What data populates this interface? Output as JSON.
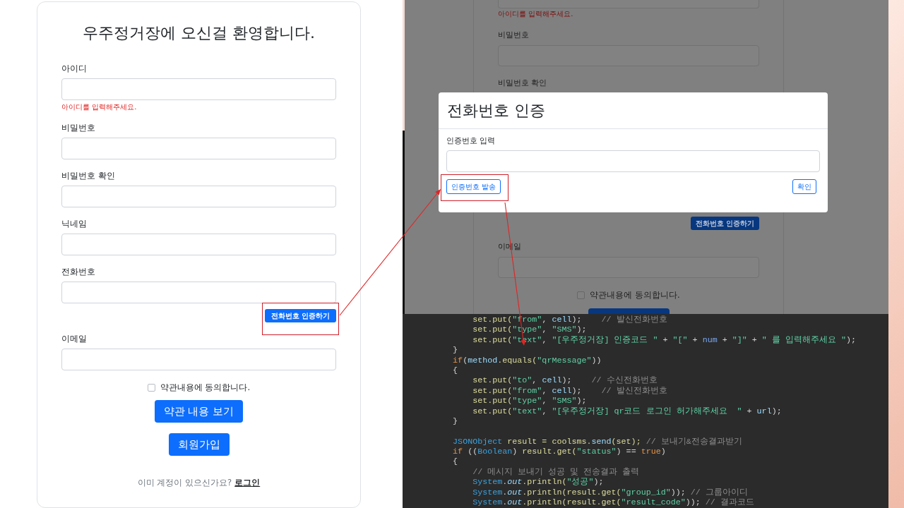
{
  "signup_page": {
    "title": "우주정거장에 오신걸 환영합니다.",
    "fields": [
      {
        "label": "아이디",
        "error": "아이디를 입력해주세요."
      },
      {
        "label": "비밀번호"
      },
      {
        "label": "비밀번호 확인"
      },
      {
        "label": "닉네임"
      },
      {
        "label": "전화번호",
        "action_button": {
          "text": "전화번호 인증하기",
          "highlighted": true
        }
      },
      {
        "label": "이메일"
      }
    ],
    "agreement": {
      "label": "약관내용에 동의합니다.",
      "checked": false
    },
    "buttons": [
      "약관 내용 보기",
      "회원가입"
    ],
    "login_prompt": {
      "text": "이미 계정이 있으신가요?",
      "link": "로그인"
    }
  },
  "background_page": {
    "upper": [
      {
        "kind": "field_bottom"
      },
      {
        "kind": "error",
        "text": "아이디를 입력해주세요."
      },
      {
        "kind": "label",
        "text": "비밀번호"
      },
      {
        "kind": "field"
      },
      {
        "kind": "label",
        "text": "비밀번호 확인"
      }
    ],
    "lower": [
      {
        "kind": "button",
        "text": "전화번호 인증하기"
      },
      {
        "kind": "label",
        "text": "이메일"
      },
      {
        "kind": "field"
      },
      {
        "kind": "checkbox",
        "text": "약관내용에 동의합니다.",
        "checked": false
      },
      {
        "kind": "button_edge"
      }
    ]
  },
  "verification_modal": {
    "title": "전화번호 인증",
    "field_label": "인증번호 입력",
    "send_button": "인증번호 발송",
    "send_highlighted": true,
    "confirm_button": "확인"
  },
  "code_editor": {
    "blocks": [
      [
        [
          {
            "kind": "ident",
            "text": "            set.put("
          },
          {
            "kind": "str",
            "text": "\"from\""
          },
          {
            "kind": "plain",
            "text": ", "
          },
          {
            "kind": "var",
            "text": "cell"
          },
          {
            "kind": "plain",
            "text": ");    "
          },
          {
            "kind": "comment",
            "text": "// 발신전화번호"
          }
        ],
        [
          {
            "kind": "ident",
            "text": "            set.put("
          },
          {
            "kind": "str",
            "text": "\"type\""
          },
          {
            "kind": "plain",
            "text": ", "
          },
          {
            "kind": "str",
            "text": "\"SMS\""
          },
          {
            "kind": "plain",
            "text": ");"
          }
        ],
        [
          {
            "kind": "ident",
            "text": "            set.put("
          },
          {
            "kind": "str",
            "text": "\"text\""
          },
          {
            "kind": "plain",
            "text": ", "
          },
          {
            "kind": "str",
            "text": "\"[우주정거장] 인증코드 \""
          },
          {
            "kind": "plain",
            "text": " + "
          },
          {
            "kind": "str",
            "text": "\"[\""
          },
          {
            "kind": "plain",
            "text": " + "
          },
          {
            "kind": "num",
            "text": "num"
          },
          {
            "kind": "plain",
            "text": " + "
          },
          {
            "kind": "str",
            "text": "\"]\""
          },
          {
            "kind": "plain",
            "text": " + "
          },
          {
            "kind": "str",
            "text": "\" 를 입력해주세요 \""
          },
          {
            "kind": "plain",
            "text": ");"
          }
        ],
        [
          {
            "kind": "plain",
            "text": "        }"
          }
        ],
        [
          {
            "kind": "kw",
            "text": "        if"
          },
          {
            "kind": "plain",
            "text": "("
          },
          {
            "kind": "var",
            "text": "method"
          },
          {
            "kind": "ident",
            "text": ".equals("
          },
          {
            "kind": "str",
            "text": "\"qrMessage\""
          },
          {
            "kind": "plain",
            "text": "))"
          }
        ],
        [
          {
            "kind": "plain",
            "text": "        {"
          }
        ],
        [
          {
            "kind": "ident",
            "text": "            set.put("
          },
          {
            "kind": "str",
            "text": "\"to\""
          },
          {
            "kind": "plain",
            "text": ", "
          },
          {
            "kind": "var",
            "text": "cell"
          },
          {
            "kind": "plain",
            "text": ");    "
          },
          {
            "kind": "comment",
            "text": "// 수신전화번호"
          }
        ],
        [
          {
            "kind": "ident",
            "text": "            set.put("
          },
          {
            "kind": "str",
            "text": "\"from\""
          },
          {
            "kind": "plain",
            "text": ", "
          },
          {
            "kind": "var",
            "text": "cell"
          },
          {
            "kind": "plain",
            "text": ");    "
          },
          {
            "kind": "comment",
            "text": "// 발신전화번호"
          }
        ],
        [
          {
            "kind": "ident",
            "text": "            set.put("
          },
          {
            "kind": "str",
            "text": "\"type\""
          },
          {
            "kind": "plain",
            "text": ", "
          },
          {
            "kind": "str",
            "text": "\"SMS\""
          },
          {
            "kind": "plain",
            "text": ");"
          }
        ],
        [
          {
            "kind": "ident",
            "text": "            set.put("
          },
          {
            "kind": "str",
            "text": "\"text\""
          },
          {
            "kind": "plain",
            "text": ", "
          },
          {
            "kind": "str",
            "text": "\"[우주정거장] qr코드 로그인 허가해주세요  \""
          },
          {
            "kind": "plain",
            "text": " + "
          },
          {
            "kind": "var",
            "text": "url"
          },
          {
            "kind": "plain",
            "text": ");"
          }
        ],
        [
          {
            "kind": "plain",
            "text": "        }"
          }
        ]
      ],
      [
        [
          {
            "kind": "type",
            "text": "        JSONObject"
          },
          {
            "kind": "ident",
            "text": " result = coolsms."
          },
          {
            "kind": "var",
            "text": "send"
          },
          {
            "kind": "ident",
            "text": "(set); "
          },
          {
            "kind": "comment",
            "text": "// 보내기&전송결과받기"
          }
        ],
        [
          {
            "kind": "kw",
            "text": "        if"
          },
          {
            "kind": "plain",
            "text": " (("
          },
          {
            "kind": "type",
            "text": "Boolean"
          },
          {
            "kind": "plain",
            "text": ") "
          },
          {
            "kind": "ident",
            "text": "result.get("
          },
          {
            "kind": "str",
            "text": "\"status\""
          },
          {
            "kind": "plain",
            "text": ") == "
          },
          {
            "kind": "kw",
            "text": "true"
          },
          {
            "kind": "plain",
            "text": ")"
          }
        ],
        [
          {
            "kind": "plain",
            "text": "        {"
          }
        ],
        [
          {
            "kind": "comment",
            "text": "            // 메시지 보내기 성공 및 전송결과 출력"
          }
        ],
        [
          {
            "kind": "type",
            "text": "            System"
          },
          {
            "kind": "plain",
            "text": "."
          },
          {
            "kind": "field",
            "text": "out"
          },
          {
            "kind": "ident",
            "text": ".println("
          },
          {
            "kind": "str",
            "text": "\"성공\""
          },
          {
            "kind": "plain",
            "text": ");"
          }
        ],
        [
          {
            "kind": "type",
            "text": "            System"
          },
          {
            "kind": "plain",
            "text": "."
          },
          {
            "kind": "field",
            "text": "out"
          },
          {
            "kind": "ident",
            "text": ".println(result.get("
          },
          {
            "kind": "str",
            "text": "\"group_id\""
          },
          {
            "kind": "plain",
            "text": ")); "
          },
          {
            "kind": "comment",
            "text": "// 그룹아이디"
          }
        ],
        [
          {
            "kind": "type",
            "text": "            System"
          },
          {
            "kind": "plain",
            "text": "."
          },
          {
            "kind": "field",
            "text": "out"
          },
          {
            "kind": "ident",
            "text": ".println(result.get("
          },
          {
            "kind": "str",
            "text": "\"result_code\""
          },
          {
            "kind": "plain",
            "text": ")); "
          },
          {
            "kind": "comment",
            "text": "// 결과코드"
          }
        ]
      ]
    ]
  }
}
